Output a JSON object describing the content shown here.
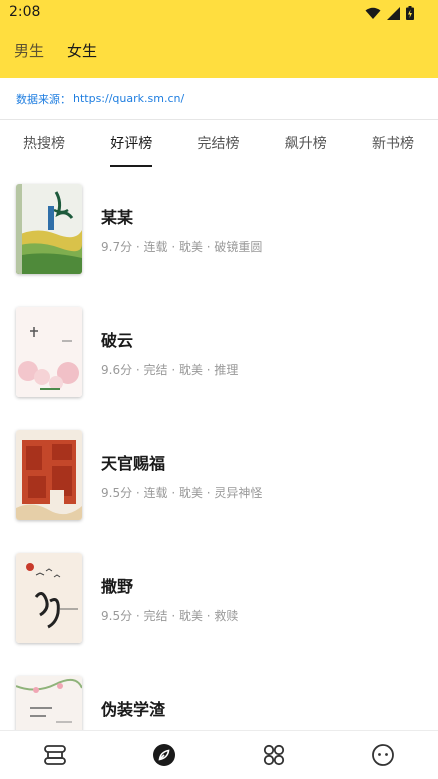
{
  "status_bar": {
    "time": "2:08",
    "icons": [
      "wifi-icon",
      "signal-icon",
      "battery-icon"
    ]
  },
  "gender_tabs": [
    {
      "label": "男生",
      "active": false
    },
    {
      "label": "女生",
      "active": true
    }
  ],
  "source": {
    "label": "数据来源：",
    "url": "https://quark.sm.cn/"
  },
  "rank_tabs": [
    {
      "label": "热搜榜",
      "active": false
    },
    {
      "label": "好评榜",
      "active": true
    },
    {
      "label": "完结榜",
      "active": false
    },
    {
      "label": "飙升榜",
      "active": false
    },
    {
      "label": "新书榜",
      "active": false
    }
  ],
  "books": [
    {
      "title": "某某",
      "meta": "9.7分 · 连载 · 耽美 · 破镜重圆"
    },
    {
      "title": "破云",
      "meta": "9.6分 · 完结 · 耽美 · 推理"
    },
    {
      "title": "天官赐福",
      "meta": "9.5分 · 连载 · 耽美 · 灵异神怪"
    },
    {
      "title": "撒野",
      "meta": "9.5分 · 完结 · 耽美 · 救赎"
    },
    {
      "title": "伪装学渣",
      "meta": ""
    }
  ],
  "bottom_nav": [
    {
      "icon": "bookshelf-icon",
      "active": false
    },
    {
      "icon": "compass-icon",
      "active": true
    },
    {
      "icon": "category-icon",
      "active": false
    },
    {
      "icon": "profile-face-icon",
      "active": false
    }
  ],
  "colors": {
    "header_bg": "#ffde3f",
    "link": "#1f7ee0",
    "meta_text": "#999999"
  }
}
